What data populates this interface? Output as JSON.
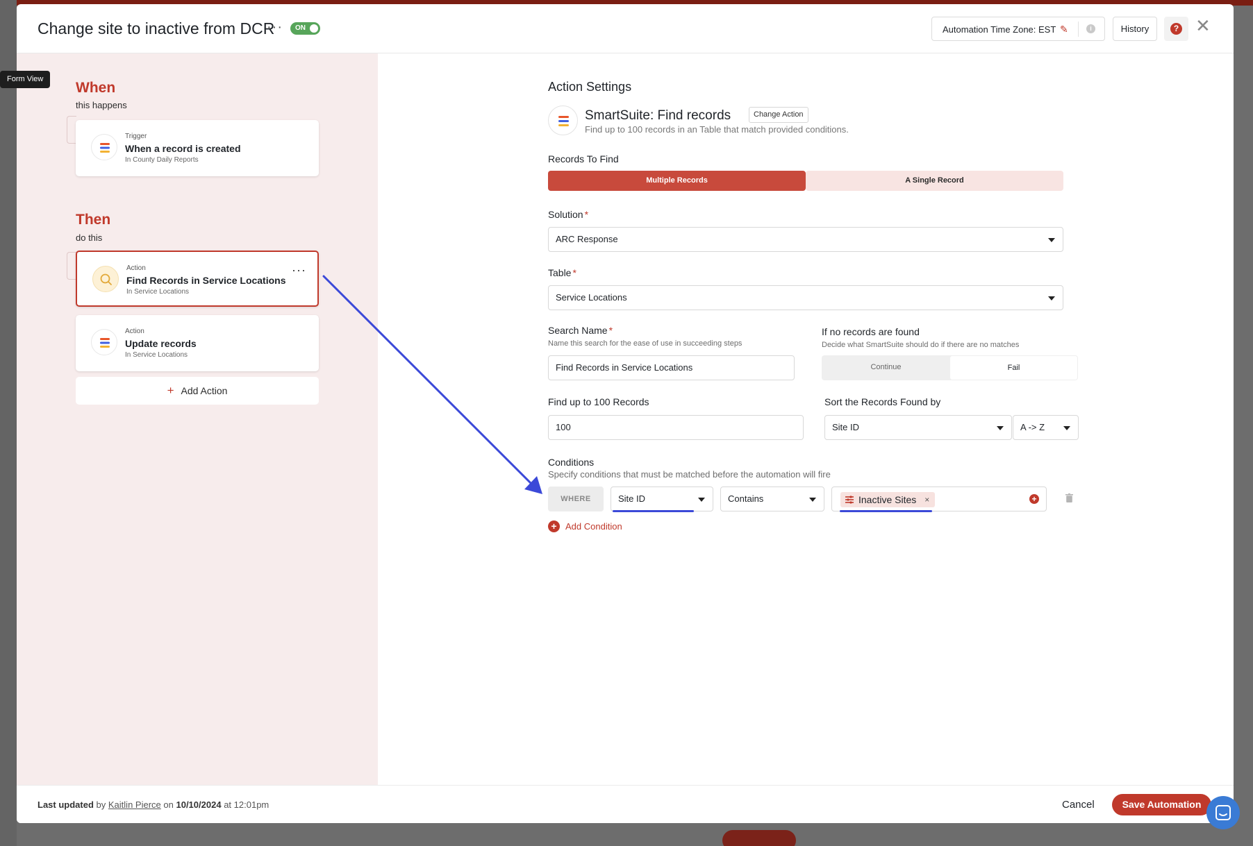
{
  "tooltip": {
    "label": "Form View"
  },
  "header": {
    "title": "Change site to inactive from DCR",
    "toggle_label": "ON",
    "timezone_label": "Automation Time Zone: EST",
    "history_label": "History",
    "help_label": "?",
    "close_label": "✕"
  },
  "workflow": {
    "when_title": "When",
    "when_sub": "this happens",
    "then_title": "Then",
    "then_sub": "do this",
    "trigger": {
      "kind": "Trigger",
      "name": "When a record is created",
      "location": "In County Daily Reports"
    },
    "actions": [
      {
        "kind": "Action",
        "name": "Find Records in Service Locations",
        "location": "In Service Locations",
        "selected": true
      },
      {
        "kind": "Action",
        "name": "Update records",
        "location": "In Service Locations",
        "selected": false
      }
    ],
    "add_action_label": "Add Action"
  },
  "settings": {
    "title": "Action Settings",
    "app_name": "SmartSuite: Find records",
    "change_action_label": "Change Action",
    "app_desc": "Find up to 100 records in an Table that match provided conditions.",
    "records_to_find_label": "Records To Find",
    "mode_options": [
      "Multiple Records",
      "A Single Record"
    ],
    "mode_selected": "Multiple Records",
    "solution_label": "Solution",
    "solution_value": "ARC Response",
    "table_label": "Table",
    "table_value": "Service Locations",
    "search_name_label": "Search Name",
    "search_name_hint": "Name this search for the ease of use in succeeding steps",
    "search_name_value": "Find Records in Service Locations",
    "no_records_label": "If no records are found",
    "no_records_hint": "Decide what SmartSuite should do if there are no matches",
    "no_records_options": [
      "Continue",
      "Fail"
    ],
    "no_records_selected": "Fail",
    "limit_label": "Find up to 100 Records",
    "limit_value": "100",
    "sort_label": "Sort the Records Found by",
    "sort_field": "Site ID",
    "sort_order": "A -> Z",
    "conditions_label": "Conditions",
    "conditions_hint": "Specify conditions that must be matched before the automation will fire",
    "condition": {
      "where_label": "WHERE",
      "field": "Site ID",
      "operator": "Contains",
      "value_chip": "Inactive Sites",
      "chip_remove": "×"
    },
    "add_condition_label": "Add Condition"
  },
  "footer": {
    "last_updated_prefix": "Last updated",
    "by_word": "by",
    "author": "Kaitlin Pierce",
    "on_word": "on",
    "date": "10/10/2024",
    "at_word": "at",
    "time": "12:01pm",
    "cancel_label": "Cancel",
    "save_label": "Save Automation"
  },
  "colors": {
    "accent": "#c0392b",
    "highlight_blue": "#3b49d8",
    "left_pane_bg": "#f7ecec"
  }
}
